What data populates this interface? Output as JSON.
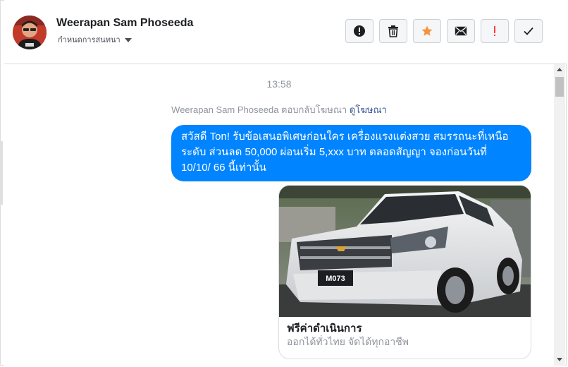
{
  "header": {
    "name": "Weerapan Sam Phoseeda",
    "subtitle": "กำหนดการสนทนา",
    "actions": [
      {
        "icon": "alert-circle-icon",
        "color": "#1c1e21"
      },
      {
        "icon": "trash-icon",
        "color": "#1c1e21"
      },
      {
        "icon": "star-icon",
        "color": "#f7923b"
      },
      {
        "icon": "envelope-icon",
        "color": "#1c1e21"
      },
      {
        "icon": "exclamation-icon",
        "color": "#fa3e3e"
      },
      {
        "icon": "check-icon",
        "color": "#1c1e21"
      }
    ]
  },
  "conversation": {
    "timestamp": "13:58",
    "notice_text": "Weerapan Sam Phoseeda ตอบกลับโฆษณา",
    "notice_link": "ดูโฆษณา",
    "message": {
      "line1": "สวัสดี Ton! รับข้อเสนอพิเศษก่อนใคร เครื่องแรงแต่งสวย สมรรถนะที่เหนือ",
      "line2": "ระดับ ส่วนลด 50,000 ผ่อนเริ่ม 5,xxx บาท ตลอดสัญญา จองก่อนวันที่",
      "line3": "10/10/ 66 นี้เท่านั้น"
    },
    "ad_card": {
      "plate": "M073",
      "title": "ฟรีค่าดำเนินการ",
      "subtitle": "ออกได้ทั่วไทย จัดได้ทุกอาชีพ"
    }
  },
  "colors": {
    "bubble": "#0084ff",
    "link": "#385898",
    "star": "#f7923b",
    "alert_red": "#fa3e3e"
  }
}
